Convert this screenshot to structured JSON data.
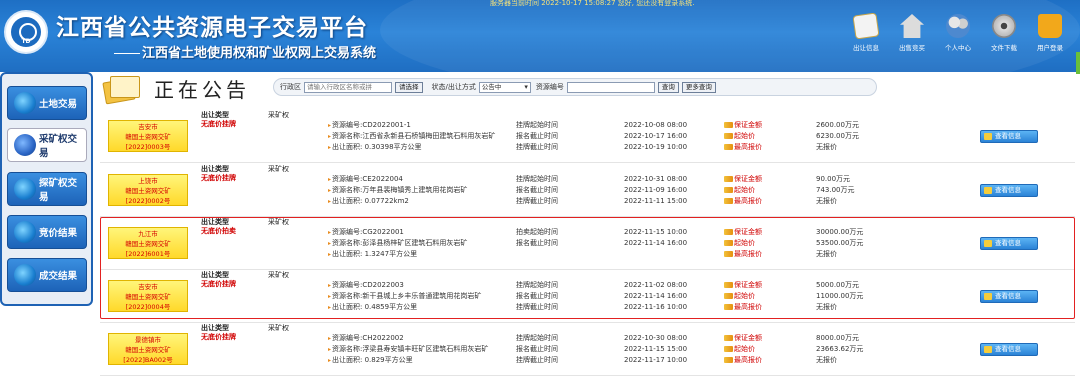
{
  "header": {
    "title": "江西省公共资源电子交易平台",
    "subtitle": "江西省土地使用权和矿业权网上交易系统",
    "marquee": "服务器当前时间 2022-10-17 15:08:27  您好, 您还没有登录系统.",
    "nav": [
      "出让信息",
      "出售竞买",
      "个人中心",
      "文件下载",
      "用户登录"
    ]
  },
  "sidebar": {
    "items": [
      {
        "label": "土地交易",
        "active": false
      },
      {
        "label": "采矿权交易",
        "active": true
      },
      {
        "label": "探矿权交易",
        "active": false
      },
      {
        "label": "竞价结果",
        "active": false
      },
      {
        "label": "成交结果",
        "active": false
      }
    ]
  },
  "notice": {
    "title": "正在公告",
    "region_label": "行政区",
    "region_placeholder": "请输入行政区名称或拼",
    "select_btn": "请选择",
    "status_label": "状态/出让方式",
    "status_value": "公告中",
    "resource_no_label": "资源编号",
    "query_btn": "查询",
    "more_btn": "更多查询"
  },
  "labels": {
    "type_label": "出让类型",
    "category": "采矿权",
    "time_labels": [
      "挂牌起始时间",
      "报名截止时间",
      "挂牌截止时间"
    ],
    "money_labels": [
      "保证金额",
      "起始价",
      "最高报价"
    ],
    "view_btn": "查看信息"
  },
  "listings": [
    {
      "badge": [
        "吉安市",
        "赣国土资网交矿",
        "[2022]0003号"
      ],
      "type": "无底价挂牌",
      "resource_no": "资源编号:CD2022001-1",
      "resource_name": "资源名称:江西省永新县石桥镇梅田建筑石料用灰岩矿",
      "area": "出让面积: 0.30398平方公里",
      "time_labels": [
        "挂牌起始时间",
        "报名截止时间",
        "挂牌截止时间"
      ],
      "times": [
        "2022-10-08 08:00",
        "2022-10-17 16:00",
        "2022-10-19 10:00"
      ],
      "money": [
        "2600.00万元",
        "6230.00万元",
        "无报价"
      ]
    },
    {
      "badge": [
        "上饶市",
        "赣国土资网交矿",
        "[2022]0002号"
      ],
      "type": "无底价挂牌",
      "resource_no": "资源编号:CE2022004",
      "resource_name": "资源名称:万年县裴梅镇秀上建筑用花岗岩矿",
      "area": "出让面积: 0.07722km2",
      "time_labels": [
        "挂牌起始时间",
        "报名截止时间",
        "挂牌截止时间"
      ],
      "times": [
        "2022-10-31 08:00",
        "2022-11-09 16:00",
        "2022-11-11 15:00"
      ],
      "money": [
        "90.00万元",
        "743.00万元",
        "无报价"
      ]
    },
    {
      "badge": [
        "九江市",
        "赣国土资网交矿",
        "[2022]6001号"
      ],
      "type": "无底价拍卖",
      "resource_no": "资源编号:CG2022001",
      "resource_name": "资源名称:彭泽县杨梓矿区建筑石料用灰岩矿",
      "area": "出让面积: 1.3247平方公里",
      "time_labels": [
        "拍卖起始时间",
        "报名截止时间",
        ""
      ],
      "times": [
        "2022-11-15 10:00",
        "2022-11-14 16:00",
        ""
      ],
      "money": [
        "30000.00万元",
        "53500.00万元",
        "无报价"
      ]
    },
    {
      "badge": [
        "吉安市",
        "赣国土资网交矿",
        "[2022]0004号"
      ],
      "type": "无底价挂牌",
      "resource_no": "资源编号:CD2022003",
      "resource_name": "资源名称:新干县城上乡丰乐普通建筑用花岗岩矿",
      "area": "出让面积: 0.4859平方公里",
      "time_labels": [
        "挂牌起始时间",
        "报名截止时间",
        "挂牌截止时间"
      ],
      "times": [
        "2022-11-02 08:00",
        "2022-11-14 16:00",
        "2022-11-16 10:00"
      ],
      "money": [
        "5000.00万元",
        "11000.00万元",
        "无报价"
      ]
    },
    {
      "badge": [
        "景德镇市",
        "赣国土资网交矿",
        "[2022]BA002号"
      ],
      "type": "无底价挂牌",
      "resource_no": "资源编号:CH2022002",
      "resource_name": "资源名称:浮梁县寿安镇丰旺矿区建筑石料用灰岩矿",
      "area": "出让面积: 0.829平方公里",
      "time_labels": [
        "挂牌起始时间",
        "报名截止时间",
        "挂牌截止时间"
      ],
      "times": [
        "2022-10-30 08:00",
        "2022-11-15 15:00",
        "2022-11-17 10:00"
      ],
      "money": [
        "8000.00万元",
        "23663.62万元",
        "无报价"
      ]
    }
  ]
}
